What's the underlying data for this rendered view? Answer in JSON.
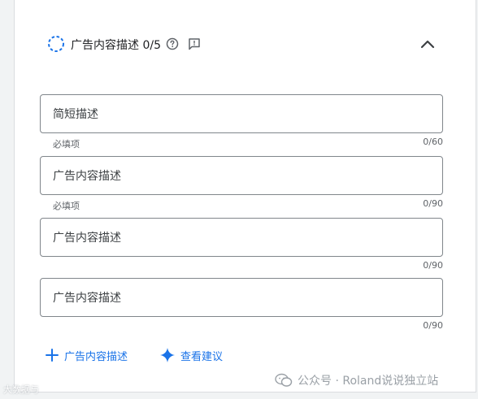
{
  "section": {
    "title": "广告内容描述",
    "count": "0/5",
    "icons": {
      "status": "dashed-circle-icon",
      "help": "help-circle-icon",
      "feedback": "feedback-icon",
      "collapse": "chevron-up-icon"
    }
  },
  "fields": [
    {
      "placeholder": "简短描述",
      "value": "",
      "hint": "必填项",
      "counter": "0/60"
    },
    {
      "placeholder": "广告内容描述",
      "value": "",
      "hint": "必填项",
      "counter": "0/90"
    },
    {
      "placeholder": "广告内容描述",
      "value": "",
      "hint": "",
      "counter": "0/90"
    },
    {
      "placeholder": "广告内容描述",
      "value": "",
      "hint": "",
      "counter": "0/90"
    }
  ],
  "actions": {
    "add_label": "广告内容描述",
    "suggest_label": "查看建议"
  },
  "watermarks": {
    "left": "大数据与",
    "right": "公众号 · Roland说说独立站"
  },
  "colors": {
    "accent": "#1a73e8",
    "border": "#80868b",
    "muted_text": "#5f6368"
  }
}
